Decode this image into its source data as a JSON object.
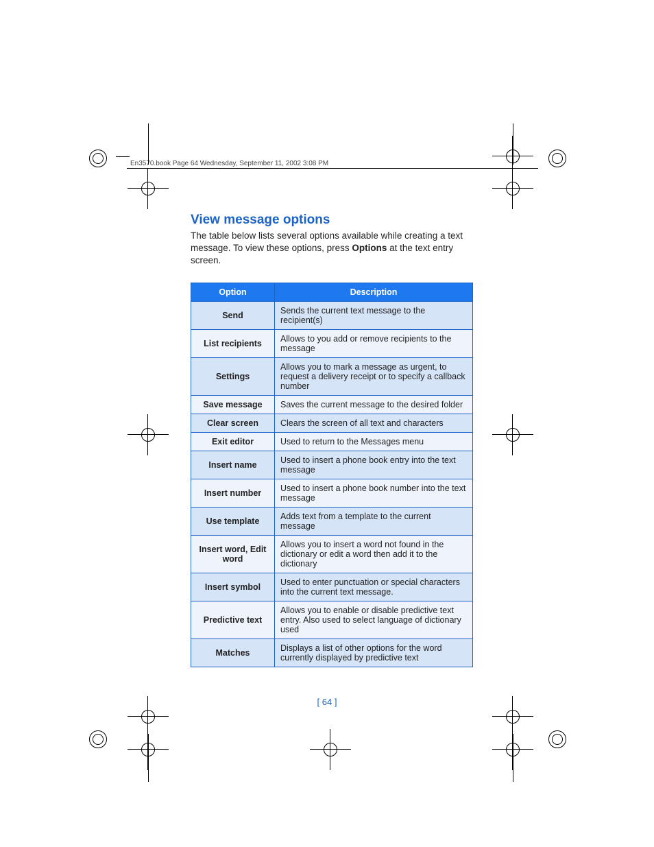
{
  "header_line": "En3570.book  Page 64  Wednesday, September 11, 2002  3:08 PM",
  "section_title": "View message options",
  "intro_before": "The table below lists several options available while creating a text message. To view these options, press ",
  "intro_bold": "Options",
  "intro_after": " at the text entry screen.",
  "table": {
    "head_option": "Option",
    "head_description": "Description",
    "rows": [
      {
        "option": "Send",
        "description": "Sends the current text message to the recipient(s)"
      },
      {
        "option": "List recipients",
        "description": "Allows to you add or remove recipients to the message"
      },
      {
        "option": "Settings",
        "description": "Allows you to mark a message as urgent, to request a delivery receipt or to specify a callback number"
      },
      {
        "option": "Save message",
        "description": "Saves the current message to the desired folder"
      },
      {
        "option": "Clear screen",
        "description": "Clears the screen of all text and characters"
      },
      {
        "option": "Exit editor",
        "description": "Used to return to the Messages menu"
      },
      {
        "option": "Insert name",
        "description": "Used to insert a phone book entry into the text message"
      },
      {
        "option": "Insert number",
        "description": "Used to insert a phone book number into the text message"
      },
      {
        "option": "Use template",
        "description": "Adds text from a template to the current message"
      },
      {
        "option": "Insert word, Edit word",
        "description": "Allows you to insert a word not found in the dictionary or edit a word then add it to the dictionary"
      },
      {
        "option": "Insert symbol",
        "description": "Used to enter punctuation or special characters into the current text message."
      },
      {
        "option": "Predictive text",
        "description": "Allows you to enable or disable predictive text entry. Also used to select language of dictionary used"
      },
      {
        "option": "Matches",
        "description": "Displays a list of other options for the word currently displayed by predictive text"
      }
    ]
  },
  "page_number": "[ 64 ]"
}
